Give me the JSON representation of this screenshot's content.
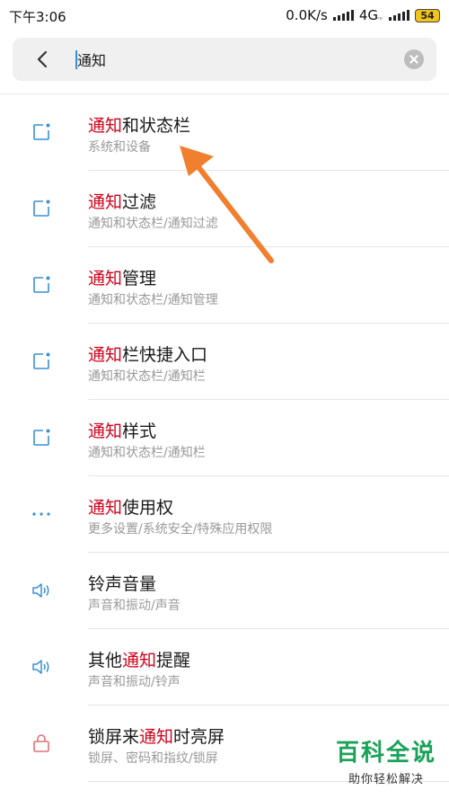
{
  "status_bar": {
    "time": "下午3:06",
    "net_speed": "0.0K/s",
    "network": "4G",
    "network_sub": "ᴴᴰ",
    "battery": "54"
  },
  "search": {
    "value": "通知",
    "placeholder": ""
  },
  "results": [
    {
      "icon": "notification-square-icon",
      "title_pre": "",
      "title_hl": "通知",
      "title_post": "和状态栏",
      "subtitle": "系统和设备"
    },
    {
      "icon": "notification-square-icon",
      "title_pre": "",
      "title_hl": "通知",
      "title_post": "过滤",
      "subtitle": "通知和状态栏/通知过滤"
    },
    {
      "icon": "notification-square-icon",
      "title_pre": "",
      "title_hl": "通知",
      "title_post": "管理",
      "subtitle": "通知和状态栏/通知管理"
    },
    {
      "icon": "notification-square-icon",
      "title_pre": "",
      "title_hl": "通知",
      "title_post": "栏快捷入口",
      "subtitle": "通知和状态栏/通知栏"
    },
    {
      "icon": "notification-square-icon",
      "title_pre": "",
      "title_hl": "通知",
      "title_post": "样式",
      "subtitle": "通知和状态栏/通知栏"
    },
    {
      "icon": "more-dots-icon",
      "title_pre": "",
      "title_hl": "通知",
      "title_post": "使用权",
      "subtitle": "更多设置/系统安全/特殊应用权限"
    },
    {
      "icon": "speaker-icon",
      "title_pre": "铃声音量",
      "title_hl": "",
      "title_post": "",
      "subtitle": "声音和振动/声音"
    },
    {
      "icon": "speaker-icon",
      "title_pre": "其他",
      "title_hl": "通知",
      "title_post": "提醒",
      "subtitle": "声音和振动/铃声"
    },
    {
      "icon": "lock-icon",
      "title_pre": "锁屏来",
      "title_hl": "通知",
      "title_post": "时亮屏",
      "subtitle": "锁屏、密码和指纹/锁屏"
    }
  ],
  "colors": {
    "highlight": "#d0021b",
    "icon_blue": "#3a8fd6",
    "icon_red": "#e0707a",
    "arrow": "#f07f2e",
    "watermark": "#1aa259"
  },
  "watermark": {
    "title": "百科全说",
    "subtitle": "助你轻松解决"
  }
}
